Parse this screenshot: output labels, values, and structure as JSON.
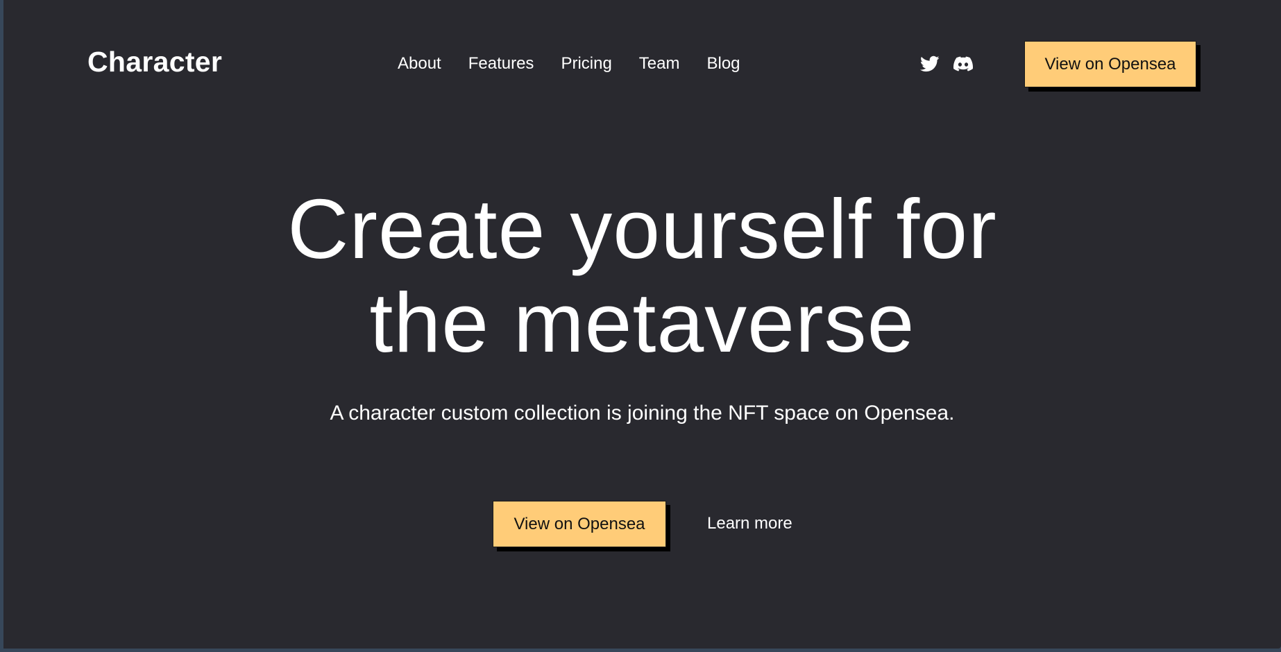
{
  "brand": {
    "logo": "Character"
  },
  "nav": {
    "items": [
      "About",
      "Features",
      "Pricing",
      "Team",
      "Blog"
    ]
  },
  "socials": [
    {
      "icon": "twitter-icon"
    },
    {
      "icon": "discord-icon"
    }
  ],
  "header_cta": {
    "label": "View on Opensea"
  },
  "hero": {
    "title_line1": "Create yourself for",
    "title_line2": "the metaverse",
    "subtitle": "A character custom collection is joining the NFT space on Opensea.",
    "primary_cta": "View on Opensea",
    "secondary_cta": "Learn more"
  },
  "colors": {
    "background": "#29292f",
    "outer_frame": "#37475a",
    "accent": "#ffcc78",
    "text": "#ffffff"
  }
}
